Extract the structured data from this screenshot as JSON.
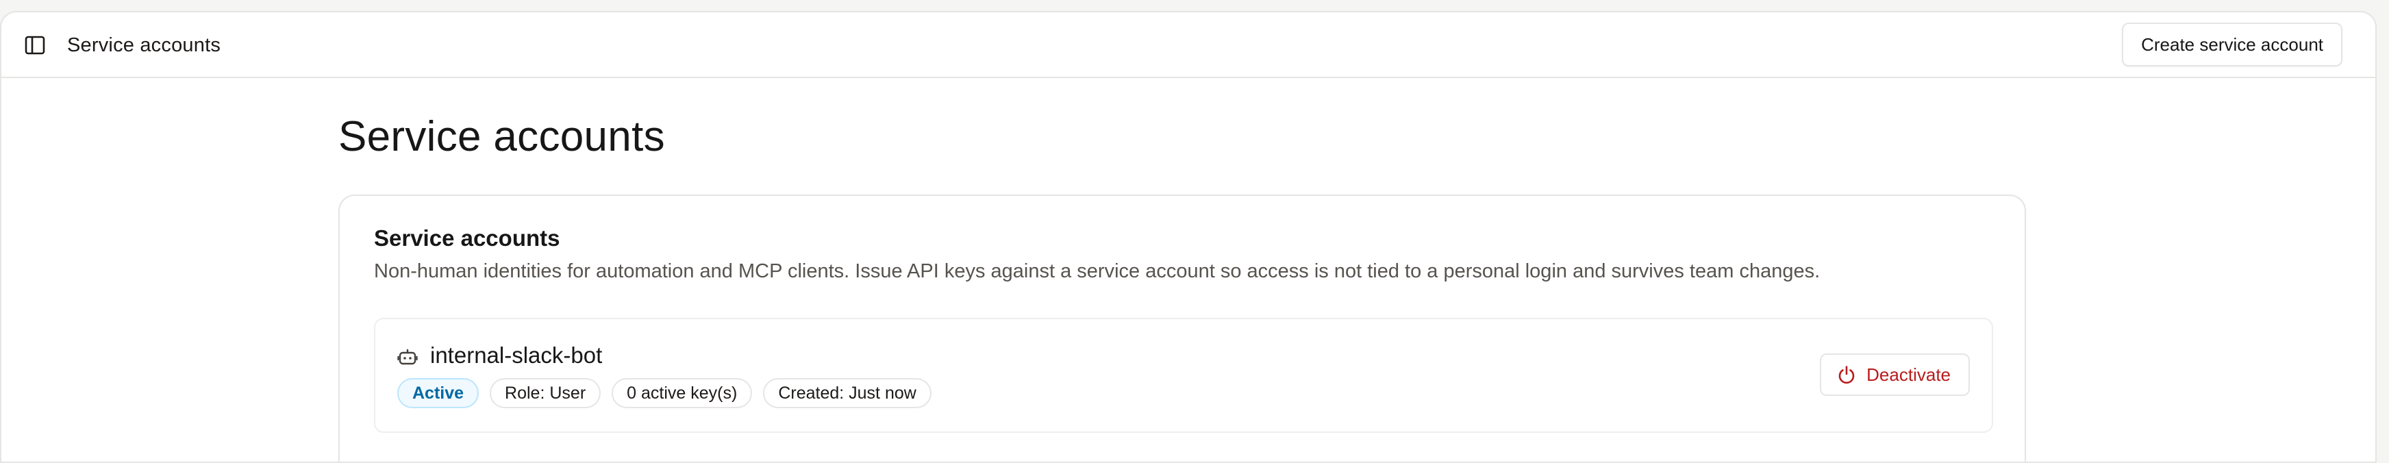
{
  "header": {
    "title": "Service accounts",
    "create_button_label": "Create service account"
  },
  "page": {
    "title": "Service accounts"
  },
  "card": {
    "title": "Service accounts",
    "description": "Non-human identities for automation and MCP clients. Issue API keys against a service account so access is not tied to a personal login and survives team changes."
  },
  "accounts": [
    {
      "name": "internal-slack-bot",
      "status": "Active",
      "role": "Role: User",
      "keys": "0 active key(s)",
      "created": "Created: Just now",
      "action_label": "Deactivate"
    }
  ],
  "icons": {
    "sidebar_toggle": "sidebar-icon",
    "account": "bot-icon",
    "deactivate": "power-icon"
  },
  "colors": {
    "active_badge_text": "#0369a1",
    "active_badge_bg": "#f0f9ff",
    "danger": "#b91c1c",
    "border": "#e7e5e4"
  }
}
